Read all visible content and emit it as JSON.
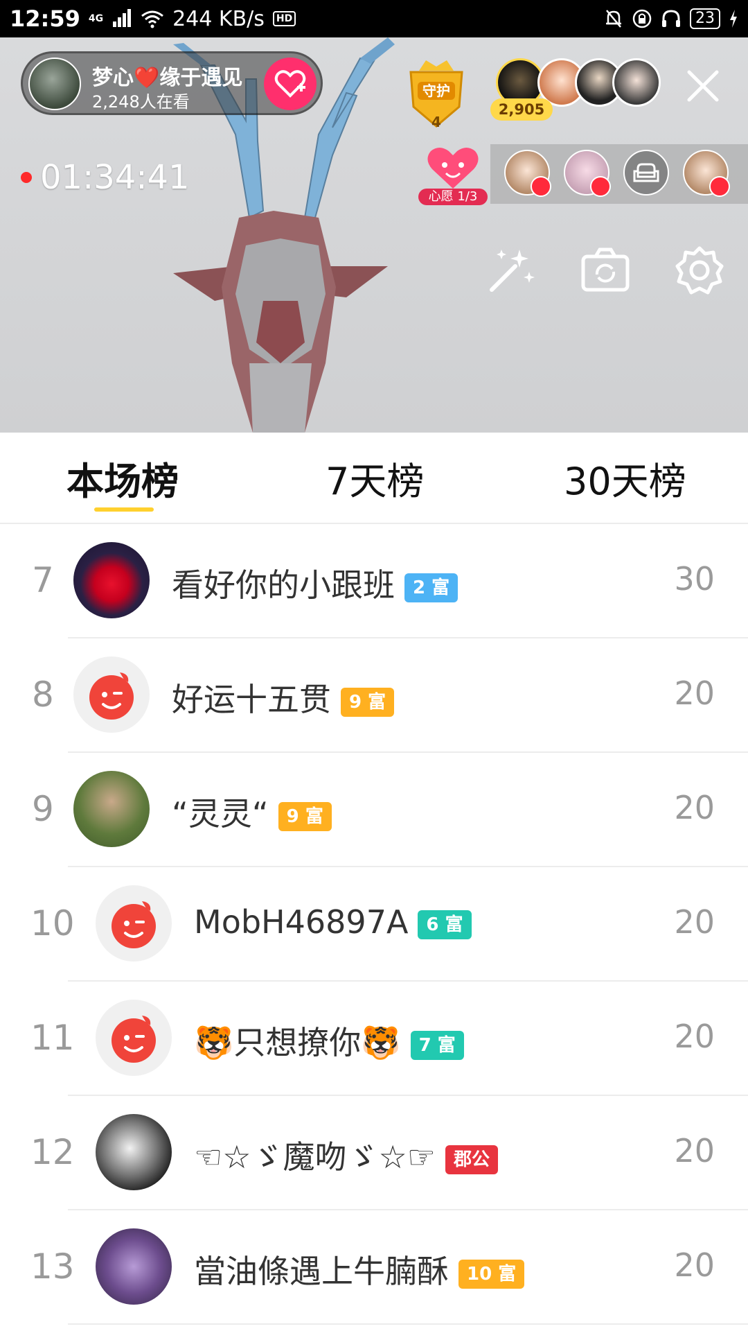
{
  "status_bar": {
    "time": "12:59",
    "network": "4G",
    "speed": "244 KB/s",
    "hd": "HD",
    "battery": "23"
  },
  "stream": {
    "host_name": "梦心❤️缘于遇见",
    "viewers": "2,248人在看",
    "guard_label": "守护",
    "guard_count": "4",
    "coin_count": "2,905",
    "timer": "01:34:41",
    "wish_label": "心愿 1/3"
  },
  "tabs": [
    {
      "label": "本场榜",
      "active": true
    },
    {
      "label": "7天榜",
      "active": false
    },
    {
      "label": "30天榜",
      "active": false
    }
  ],
  "rank_list": [
    {
      "rank": "7",
      "name": "看好你的小跟班",
      "badge": "2 富",
      "badge_color": "#4db3f5",
      "score": "30",
      "avatar": "heart"
    },
    {
      "rank": "8",
      "name": "好运十五贯",
      "badge": "9 富",
      "badge_color": "#ffb020",
      "score": "20",
      "avatar": "default"
    },
    {
      "rank": "9",
      "name": "“灵灵“",
      "badge": "9 富",
      "badge_color": "#ffb020",
      "score": "20",
      "avatar": "photo-green"
    },
    {
      "rank": "10",
      "name": "MobH46897A",
      "badge": "6 富",
      "badge_color": "#22c9b0",
      "score": "20",
      "avatar": "default"
    },
    {
      "rank": "11",
      "name": "🐯只想撩你🐯",
      "badge": "7 富",
      "badge_color": "#22c9b0",
      "score": "20",
      "avatar": "default"
    },
    {
      "rank": "12",
      "name": "☜☆ゞ魔吻ゞ☆☞",
      "badge": "郡公",
      "badge_color": "#e8343f",
      "score": "20",
      "avatar": "photo-bw"
    },
    {
      "rank": "13",
      "name": "當油條遇上牛腩酥",
      "badge": "10 富",
      "badge_color": "#ffb020",
      "score": "20",
      "avatar": "photo-purple"
    }
  ]
}
